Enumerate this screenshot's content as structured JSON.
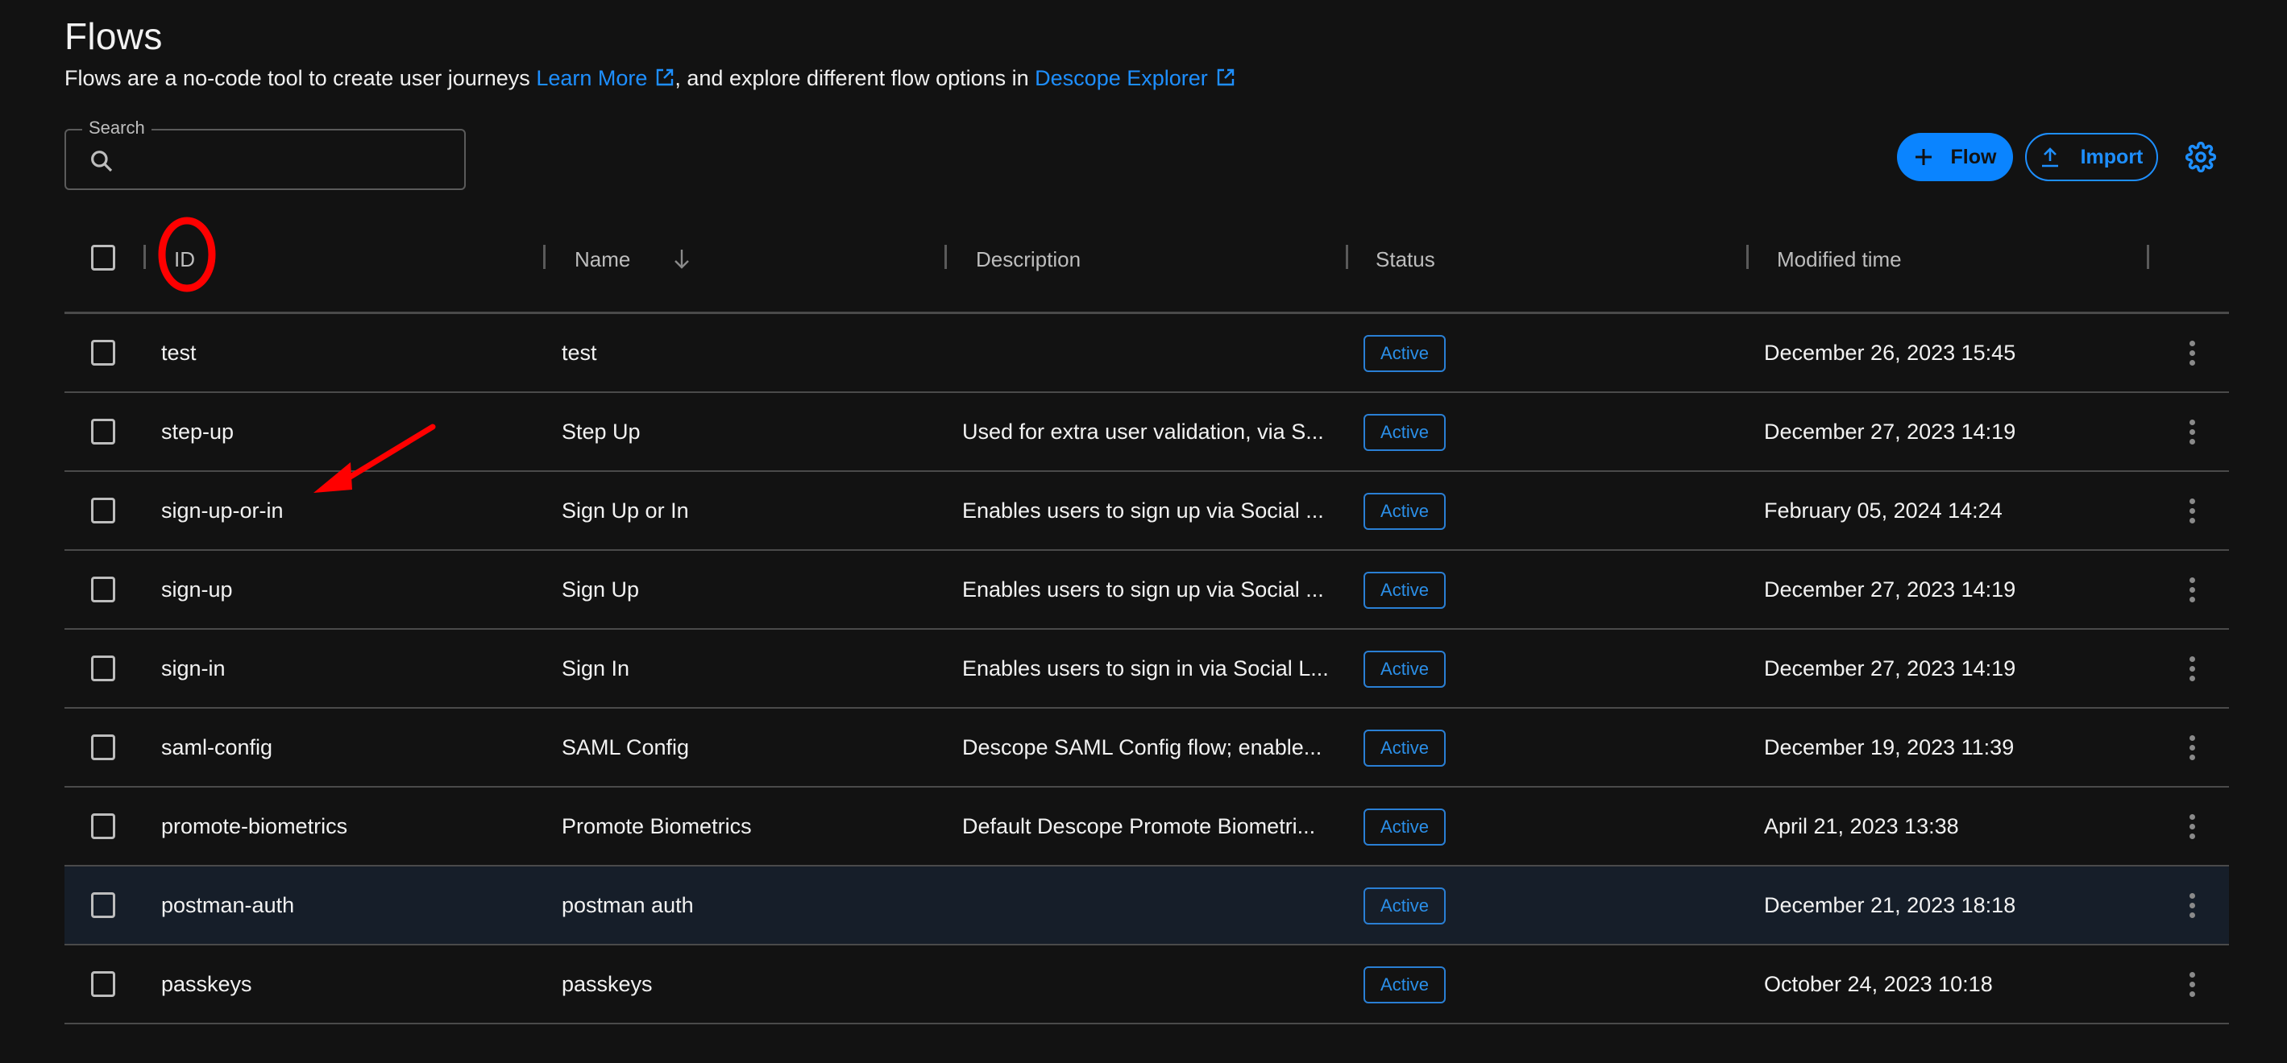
{
  "header": {
    "title": "Flows",
    "subtitle_prefix": "Flows are a no-code tool to create user journeys ",
    "learn_more_link": "Learn More",
    "subtitle_middle": ", and explore different flow options in ",
    "explorer_link": "Descope Explorer",
    "link_icon": "external-link-icon"
  },
  "search": {
    "label": "Search",
    "value": "",
    "placeholder": "",
    "icon": "search-icon"
  },
  "toolbar": {
    "add_flow_label": "Flow",
    "add_flow_icon": "plus-icon",
    "import_label": "Import",
    "import_icon": "upload-icon",
    "settings_icon": "gear-icon"
  },
  "colors": {
    "accent": "#0a84ff",
    "link": "#1e8fff",
    "status_active": "#2b8fe8",
    "background": "#121212",
    "row_hover": "#161e29",
    "annotation": "#ff0000"
  },
  "table": {
    "columns": {
      "id": "ID",
      "name": "Name",
      "description": "Description",
      "status": "Status",
      "modified": "Modified time"
    },
    "sort": {
      "column": "Name",
      "direction": "descending",
      "icon": "arrow-down-icon"
    },
    "rows": [
      {
        "id": "test",
        "name": "test",
        "description": "",
        "status": "Active",
        "modified": "December 26, 2023 15:45"
      },
      {
        "id": "step-up",
        "name": "Step Up",
        "description": "Used for extra user validation, via S...",
        "status": "Active",
        "modified": "December 27, 2023 14:19"
      },
      {
        "id": "sign-up-or-in",
        "name": "Sign Up or In",
        "description": "Enables users to sign up via Social ...",
        "status": "Active",
        "modified": "February 05, 2024 14:24"
      },
      {
        "id": "sign-up",
        "name": "Sign Up",
        "description": "Enables users to sign up via Social ...",
        "status": "Active",
        "modified": "December 27, 2023 14:19"
      },
      {
        "id": "sign-in",
        "name": "Sign In",
        "description": "Enables users to sign in via Social L...",
        "status": "Active",
        "modified": "December 27, 2023 14:19"
      },
      {
        "id": "saml-config",
        "name": "SAML Config",
        "description": "Descope SAML Config flow; enable...",
        "status": "Active",
        "modified": "December 19, 2023 11:39"
      },
      {
        "id": "promote-biometrics",
        "name": "Promote Biometrics",
        "description": "Default Descope Promote Biometri...",
        "status": "Active",
        "modified": "April 21, 2023 13:38"
      },
      {
        "id": "postman-auth",
        "name": "postman auth",
        "description": "",
        "status": "Active",
        "modified": "December 21, 2023 18:18",
        "hovered": true
      },
      {
        "id": "passkeys",
        "name": "passkeys",
        "description": "",
        "status": "Active",
        "modified": "October 24, 2023 10:18"
      }
    ]
  },
  "annotations": {
    "circle_target": "ID column header",
    "arrow_target": "sign-up-or-in"
  }
}
